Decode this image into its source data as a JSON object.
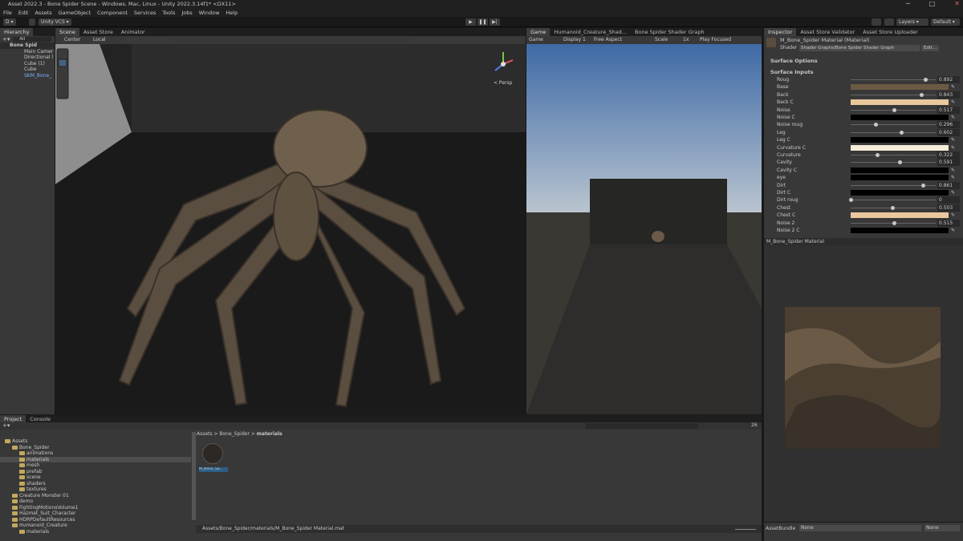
{
  "window": {
    "title": "Asset 2022.3 - Bone Spider Scene - Windows, Mac, Linux - Unity 2022.3.14f1* <DX11>",
    "controls": [
      "─",
      "□",
      "✕"
    ]
  },
  "menu": [
    "File",
    "Edit",
    "Assets",
    "GameObject",
    "Component",
    "Services",
    "Tools",
    "Jobs",
    "Window",
    "Help"
  ],
  "toolbar": {
    "account": "D ▾",
    "vcs": "Unity VCS ▾",
    "layers": "Layers ▾",
    "layout": "Default ▾"
  },
  "hierarchy": {
    "tab": "Hierarchy",
    "search": "All",
    "items": [
      "Bone Spid",
      "Main Camer",
      "Directional l",
      "Cube (1)",
      "Cube",
      "SKM_Bone_"
    ]
  },
  "scene": {
    "tabs": [
      "Scene",
      "Asset Store",
      "Animator"
    ],
    "pivot": "Center",
    "space": "Local",
    "persp": "< Persp"
  },
  "game": {
    "tabs": [
      "Game",
      "Humanoid_Creature_Shad...",
      "Bone Spider Shader Graph"
    ],
    "mode": "Game",
    "display": "Display 1",
    "aspect": "Free Aspect",
    "scale_label": "Scale",
    "scale": "1x",
    "focus": "Play Focused"
  },
  "inspector": {
    "tabs": [
      "Inspector",
      "Asset Store Validator",
      "Asset Store Uploader"
    ],
    "material": "M_Bone_Spider Material (Material)",
    "shader_label": "Shader",
    "shader": "Shader Graphs/Bone Spider Shader Graph",
    "edit": "Edit...",
    "surface_options": "Surface Options",
    "surface_inputs": "Surface Inputs",
    "props": [
      {
        "name": "Roug",
        "type": "slider",
        "value": "0.892",
        "frac": 0.892
      },
      {
        "name": "Base",
        "type": "color",
        "color": "#6b5a43"
      },
      {
        "name": "Back",
        "type": "slider",
        "value": "0.843",
        "frac": 0.843
      },
      {
        "name": "Back C",
        "type": "color",
        "color": "#e8c79c"
      },
      {
        "name": "Noise",
        "type": "slider",
        "value": "0.517",
        "frac": 0.517
      },
      {
        "name": "Noise C",
        "type": "color",
        "color": "#000000"
      },
      {
        "name": "Noise roug",
        "type": "slider",
        "value": "0.296",
        "frac": 0.296
      },
      {
        "name": "Leg",
        "type": "slider",
        "value": "0.602",
        "frac": 0.602
      },
      {
        "name": "Leg C",
        "type": "color",
        "color": "#000000"
      },
      {
        "name": "Curvature C",
        "type": "color",
        "color": "#f5ecd9"
      },
      {
        "name": "Curvature",
        "type": "slider",
        "value": "0.322",
        "frac": 0.322
      },
      {
        "name": "Cavity",
        "type": "slider",
        "value": "0.591",
        "frac": 0.591
      },
      {
        "name": "Cavity C",
        "type": "color",
        "color": "#000000"
      },
      {
        "name": "eye",
        "type": "color",
        "color": "#000000"
      },
      {
        "name": "Dirt",
        "type": "slider",
        "value": "0.861",
        "frac": 0.861
      },
      {
        "name": "Dirt C",
        "type": "color",
        "color": "#000000"
      },
      {
        "name": "Dirt roug",
        "type": "slider",
        "value": "0",
        "frac": 0
      },
      {
        "name": "Chest",
        "type": "slider",
        "value": "0.503",
        "frac": 0.503
      },
      {
        "name": "Chest C",
        "type": "color",
        "color": "#e9c8a0"
      },
      {
        "name": "Noise 2",
        "type": "slider",
        "value": "0.515",
        "frac": 0.515
      },
      {
        "name": "Noise 2 C",
        "type": "color",
        "color": "#000000"
      }
    ]
  },
  "preview": {
    "title": "M_Bone_Spider Material",
    "assetbundle_label": "AssetBundle",
    "bundle": "None",
    "variant": "None"
  },
  "project": {
    "tabs": [
      "Project",
      "Console"
    ],
    "breadcrumb": [
      "Assets",
      "Bone_Spider",
      "materials"
    ],
    "asset": "M_Bone_Sp...",
    "path": "Assets/Bone_Spider/materials/M_Bone_Spider Material.mat",
    "count": "26",
    "tree": [
      {
        "label": "Assets",
        "indent": 0
      },
      {
        "label": "Bone_Spider",
        "indent": 1
      },
      {
        "label": "animations",
        "indent": 2
      },
      {
        "label": "materials",
        "indent": 2
      },
      {
        "label": "mesh",
        "indent": 2
      },
      {
        "label": "prefab",
        "indent": 2
      },
      {
        "label": "scene",
        "indent": 2
      },
      {
        "label": "shaders",
        "indent": 2
      },
      {
        "label": "textures",
        "indent": 2
      },
      {
        "label": "Creature Monster 01",
        "indent": 1
      },
      {
        "label": "demo",
        "indent": 1
      },
      {
        "label": "FightingMotionsVolume1",
        "indent": 1
      },
      {
        "label": "Hazmat_Suit_Character",
        "indent": 1
      },
      {
        "label": "HDRPDefaultResources",
        "indent": 1
      },
      {
        "label": "Humanoid_Creature",
        "indent": 1
      },
      {
        "label": "materials",
        "indent": 2
      }
    ]
  }
}
